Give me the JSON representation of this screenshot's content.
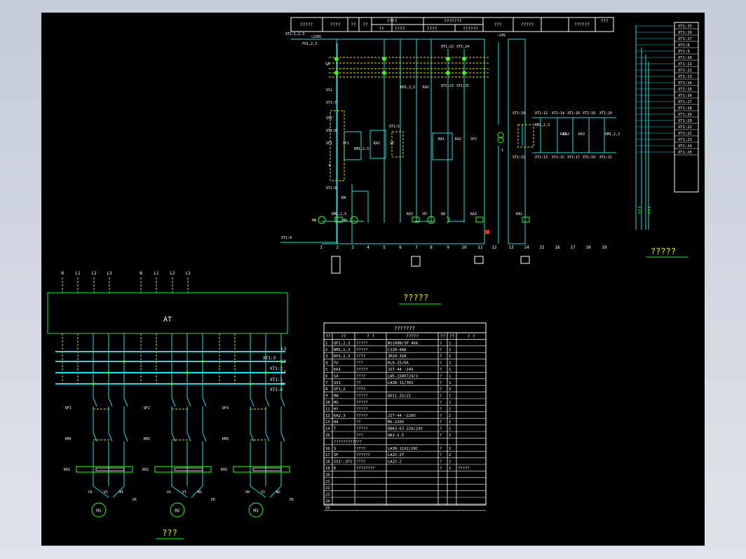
{
  "colors": {
    "background": "#000000",
    "wire": "#22e0e0",
    "frame": "#ffffff",
    "label": "#ffffff",
    "terminal": "#ffffff",
    "dashed": "#e6e600",
    "accent": "#00ff33",
    "lamp": "#39ff14",
    "red": "#ff2020"
  },
  "control": {
    "header": {
      "top": [
        "?????",
        "????",
        "??",
        "??",
        "????",
        "???????",
        "???",
        "?????",
        "??????",
        "???"
      ],
      "sub": [
        "??",
        "????",
        "????",
        "??????"
      ]
    },
    "voltage_left": "~220V",
    "voltage_right": "~24V",
    "labels": {
      "xt_top": "XT1:1,2,3",
      "fu": "FU1,2,3",
      "sa": "SA",
      "ss1": "SS1",
      "xt1_7": "XT1:7",
      "ss1b": "SS1'",
      "xt1_8": "XT1:8",
      "sf1": "SF1",
      "sf1b": "SF1",
      "km1_23": "KM1,2,3",
      "ka1": "KA1",
      "xt1_5": "XT1:5",
      "sf": "SF",
      "kh": "KH1,2,3",
      "ka2": "KA2",
      "xt22": "XT1:22",
      "xt24": "XT1:24",
      "xt23": "XT1:23",
      "xt25": "XT1:25",
      "k": "K",
      "xt1_6": "XT1:6",
      "km": "KM",
      "hw": "HW",
      "hg": "HG",
      "kmr": "KM1,2,3",
      "hy": "HY",
      "ha": "HA",
      "ka3": "KA3",
      "xt1_4": "XT1:4",
      "sf2": "SF2",
      "ka1b": "KA1",
      "ka2b": "KA2",
      "ka3b": "KA3",
      "ka1c": "KA1",
      "t1": "1",
      "xt1_10": "XT1:10",
      "xt1_11": "XT1:11",
      "xt12": "XT1:12",
      "xt13": "XT1:13",
      "xt14": "XT1:14",
      "xt15": "XT1:15",
      "xt16": "XT1:16",
      "xt17": "XT1:17",
      "xt18": "XT1:18",
      "xt19": "XT1:19",
      "xt20": "XT1:20",
      "xt21": "XT1:21",
      "ka1r": "KA1",
      "ka2r": "KA2",
      "ka3r": "KA3",
      "kmr2": "KM1,2,3",
      "kmr3": "KM1,2,3"
    },
    "column_numbers": [
      "1",
      "2",
      "3",
      "4",
      "5",
      "6",
      "7",
      "8",
      "9",
      "10",
      "11",
      "12",
      "13",
      "14",
      "15",
      "16",
      "17",
      "18",
      "19"
    ],
    "title": "?????"
  },
  "terminal_strip": {
    "items": [
      "XT1:15",
      "XT1:16",
      "XT1:17",
      "XT1:8",
      "XT1:9",
      "XT1:10",
      "XT1:11",
      "XT1:12",
      "XT1:13",
      "XT1:14",
      "XT1:15",
      "XT1:16",
      "XT1:17",
      "XT1:18",
      "XT1:19",
      "XT1:20",
      "XT1:21",
      "XT1:22",
      "XT1:23",
      "XT1:24",
      "XT1:25"
    ],
    "title": "?????"
  },
  "power": {
    "inputs": [
      "N",
      "L1",
      "L2",
      "L3",
      "N",
      "L1",
      "L2",
      "L3"
    ],
    "at": "AT",
    "bus": [
      "L3",
      "L2",
      "L1",
      "N"
    ],
    "bus_xt": [
      "XT1:3",
      "XT1:2",
      "XT1:1",
      "XT1:4"
    ],
    "motors": [
      {
        "qf": "QF1",
        "km": "KM1",
        "kh": "KH1",
        "u": "U1",
        "v": "V1",
        "w": "W1",
        "pe": "PE",
        "m": "M1"
      },
      {
        "qf": "QF2",
        "km": "KM2",
        "kh": "KH2",
        "u": "U1",
        "v": "V1",
        "w": "W1",
        "pe": "PE",
        "m": "M2"
      },
      {
        "qf": "QF3",
        "km": "KM3",
        "kh": "KH3",
        "u": "U0",
        "v": "V2",
        "w": "W2",
        "pe": "PE",
        "m": "M3"
      }
    ],
    "title": "???"
  },
  "table": {
    "title": "???????",
    "headers": [
      "??",
      "??",
      "?  ?",
      "?????",
      "??",
      "??",
      "?  ?"
    ],
    "rows": [
      [
        "1",
        "QF1,2,3",
        "?????",
        "NS100N/3P 40A",
        "?",
        "1",
        ""
      ],
      [
        "2",
        "KM1,2,3",
        "?????",
        "CJ20-40A",
        "?",
        "1",
        ""
      ],
      [
        "3",
        "KH1,2,3",
        "????",
        "JR20-32A",
        "?",
        "1",
        ""
      ],
      [
        "4",
        "FU",
        "???",
        "RL6-25/6A",
        "?",
        "1",
        ""
      ],
      [
        "5",
        "KA1",
        "?????",
        "JZ7-44 ~24V",
        "?",
        "1",
        ""
      ],
      [
        "6",
        "SA",
        "????",
        "LW5-15D0724/3",
        "?",
        "1",
        ""
      ],
      [
        "7",
        "SS1",
        "??",
        "LA38-11/301",
        "?",
        "1",
        ""
      ],
      [
        "8",
        "SF1,2",
        "????",
        "",
        "?",
        "2",
        ""
      ],
      [
        "9",
        "HW",
        "?????",
        "AD11-25/21",
        "?",
        "1",
        ""
      ],
      [
        "10",
        "HG",
        "?????",
        "",
        "?",
        "1",
        ""
      ],
      [
        "11",
        "HY",
        "?????",
        "",
        "?",
        "1",
        ""
      ],
      [
        "12",
        "KA2,3",
        "?????",
        "JZ7-44 ~220V",
        "?",
        "2",
        ""
      ],
      [
        "13",
        "HA",
        "??",
        "MS-220V",
        "?",
        "1",
        ""
      ],
      [
        "14",
        "T",
        "?????",
        "DBK3-63 220/24V",
        "?",
        "1",
        ""
      ],
      [
        "15",
        "",
        "???",
        "UK2-2.5",
        "?",
        "1",
        ""
      ],
      [
        "",
        "????????????",
        "",
        "",
        "",
        "",
        ""
      ],
      [
        "16",
        "S",
        "????",
        "LA38-11X2/20C",
        "?",
        "1",
        ""
      ],
      [
        "17",
        "SF",
        "??????",
        "LA25-2T",
        "?",
        "2",
        ""
      ],
      [
        "18",
        "SS1',SF1'",
        "????",
        "LA25-2",
        "?",
        "1",
        ""
      ],
      [
        "19",
        "K",
        "????????",
        "",
        "?",
        "1",
        "?????"
      ],
      [
        "20",
        "",
        "",
        "",
        "",
        "",
        ""
      ],
      [
        "21",
        "",
        "",
        "",
        "",
        "",
        ""
      ],
      [
        "22",
        "",
        "",
        "",
        "",
        "",
        ""
      ],
      [
        "23",
        "",
        "",
        "",
        "",
        "",
        ""
      ],
      [
        "24",
        "",
        "",
        "",
        "",
        "",
        ""
      ],
      [
        "25",
        "",
        "",
        "",
        "",
        "",
        ""
      ]
    ]
  }
}
